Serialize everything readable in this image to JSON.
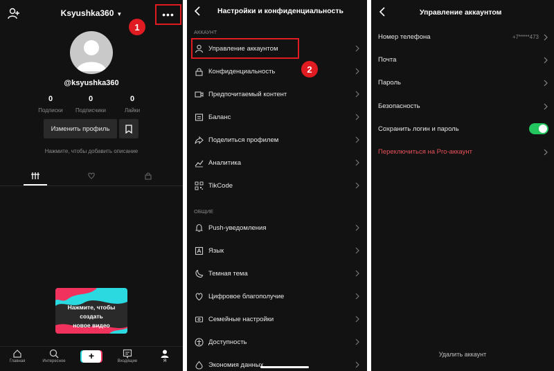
{
  "colors": {
    "background": "#121212",
    "highlight": "#e01b22",
    "toggle_on": "#22c55e",
    "pro_link": "#e8515a"
  },
  "profile": {
    "username": "Ksyushka360",
    "handle": "@ksyushka360",
    "more_label": "•••",
    "badge1": "1",
    "stats": [
      {
        "num": "0",
        "label": "Подписки"
      },
      {
        "num": "0",
        "label": "Подписчики"
      },
      {
        "num": "0",
        "label": "Лайки"
      }
    ],
    "edit_button": "Изменить профиль",
    "bio_hint": "Нажмите, чтобы добавить описание",
    "promo": [
      "Нажмите, чтобы",
      "создать",
      "новое видео"
    ],
    "nav": {
      "home": "Главная",
      "discover": "Интересное",
      "plus": "+",
      "inbox": "Входящие",
      "me": "Я"
    }
  },
  "settings": {
    "title": "Настройки и конфиденциальность",
    "badge2": "2",
    "section_account": "АККАУНТ",
    "section_general": "ОБЩИЕ",
    "account_items": [
      {
        "icon": "person-icon",
        "label": "Управление аккаунтом"
      },
      {
        "icon": "lock-icon",
        "label": "Конфиденциальность"
      },
      {
        "icon": "video-icon",
        "label": "Предпочитаемый контент"
      },
      {
        "icon": "wallet-icon",
        "label": "Баланс"
      },
      {
        "icon": "share-icon",
        "label": "Поделиться профилем"
      },
      {
        "icon": "analytics-icon",
        "label": "Аналитика"
      },
      {
        "icon": "qr-icon",
        "label": "TikCode"
      }
    ],
    "general_items": [
      {
        "icon": "bell-icon",
        "label": "Push-уведомления"
      },
      {
        "icon": "language-icon",
        "label": "Язык"
      },
      {
        "icon": "moon-icon",
        "label": "Темная тема"
      },
      {
        "icon": "wellbeing-icon",
        "label": "Цифровое благополучие"
      },
      {
        "icon": "family-icon",
        "label": "Семейные настройки"
      },
      {
        "icon": "accessibility-icon",
        "label": "Доступность"
      },
      {
        "icon": "data-icon",
        "label": "Экономия данных"
      }
    ]
  },
  "account": {
    "title": "Управление аккаунтом",
    "phone_label": "Номер телефона",
    "phone_value": "+7*****473",
    "email_label": "Почта",
    "password_label": "Пароль",
    "security_label": "Безопасность",
    "save_login_label": "Сохранить логин и пароль",
    "save_login_on": true,
    "pro_label": "Переключиться на Pro-аккаунт",
    "delete_label": "Удалить аккаунт"
  }
}
